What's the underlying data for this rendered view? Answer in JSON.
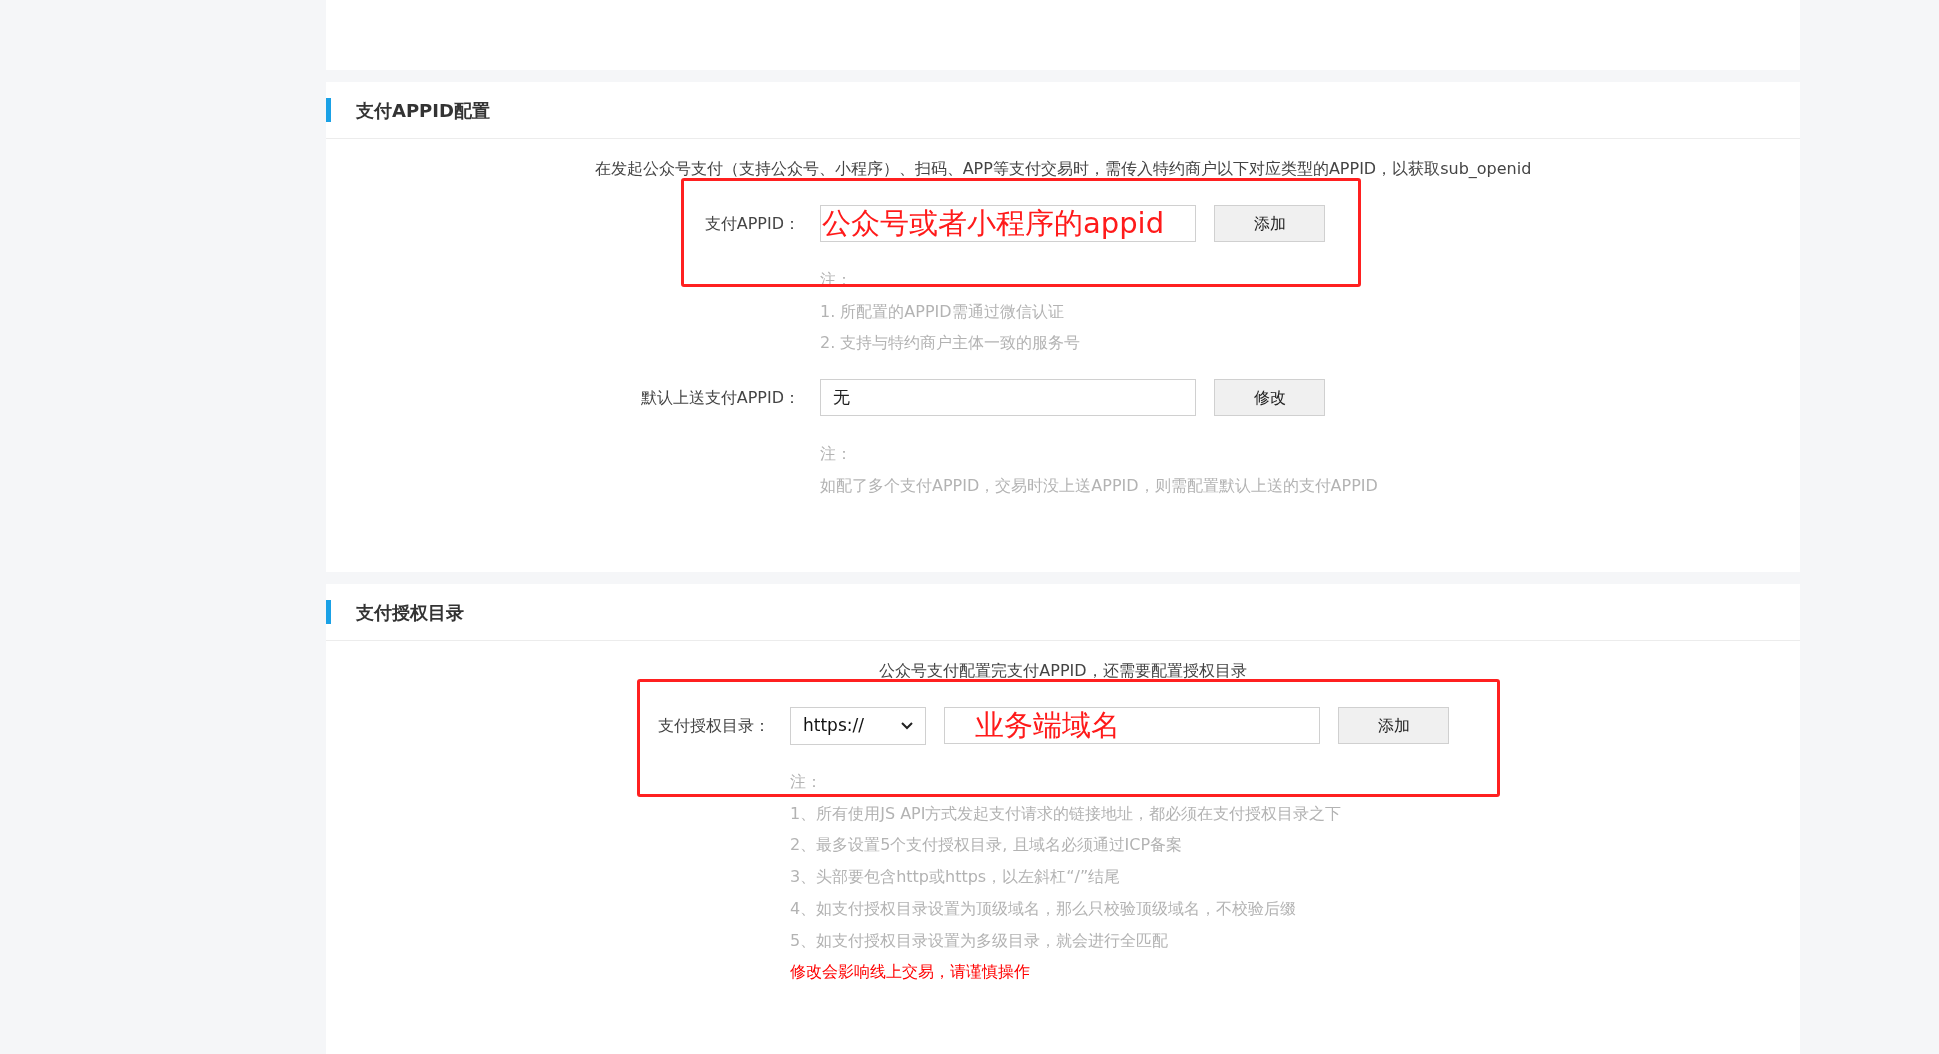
{
  "sections": [
    {
      "title": "支付APPID配置",
      "intro": "在发起公众号支付（支持公众号、小程序）、扫码、APP等支付交易时，需传入特约商户以下对应类型的APPID，以获取sub_openid",
      "rows": [
        {
          "kind": "input",
          "label": "支付APPID：",
          "value": "",
          "annotation": "公众号或者小程序的appid",
          "button": "添加",
          "highlighted": true,
          "notes": [
            {
              "kind": "hint",
              "text": "注："
            },
            {
              "kind": "hint",
              "text": "1. 所配置的APPID需通过微信认证"
            },
            {
              "kind": "hint",
              "text": "2. 支持与特约商户主体一致的服务号"
            }
          ]
        },
        {
          "kind": "input",
          "label": "默认上送支付APPID：",
          "value": "无",
          "button": "修改",
          "highlighted": false,
          "notes": [
            {
              "kind": "hint",
              "text": "注："
            },
            {
              "kind": "hint",
              "text": "如配了多个支付APPID，交易时没上送APPID，则需配置默认上送的支付APPID"
            }
          ]
        }
      ]
    },
    {
      "title": "支付授权目录",
      "intro": "公众号支付配置完支付APPID，还需要配置授权目录",
      "rows": [
        {
          "kind": "select-input",
          "label": "支付授权目录：",
          "select": "https://",
          "value": "",
          "annotation": "业务端域名",
          "button": "添加",
          "highlighted": true,
          "notes": [
            {
              "kind": "hint",
              "text": "注："
            },
            {
              "kind": "hint",
              "text": "1、所有使用JS API方式发起支付请求的链接地址，都必须在支付授权目录之下"
            },
            {
              "kind": "hint",
              "text": "2、最多设置5个支付授权目录, 且域名必须通过ICP备案"
            },
            {
              "kind": "hint",
              "text": "3、头部要包含http或https，以左斜杠“/”结尾"
            },
            {
              "kind": "hint",
              "text": "4、如支付授权目录设置为顶级域名，那么只校验顶级域名，不校验后缀"
            },
            {
              "kind": "hint",
              "text": "5、如支付授权目录设置为多级目录，就会进行全匹配"
            },
            {
              "kind": "warning",
              "text": "修改会影响线上交易，请谨慎操作"
            }
          ]
        }
      ]
    }
  ]
}
